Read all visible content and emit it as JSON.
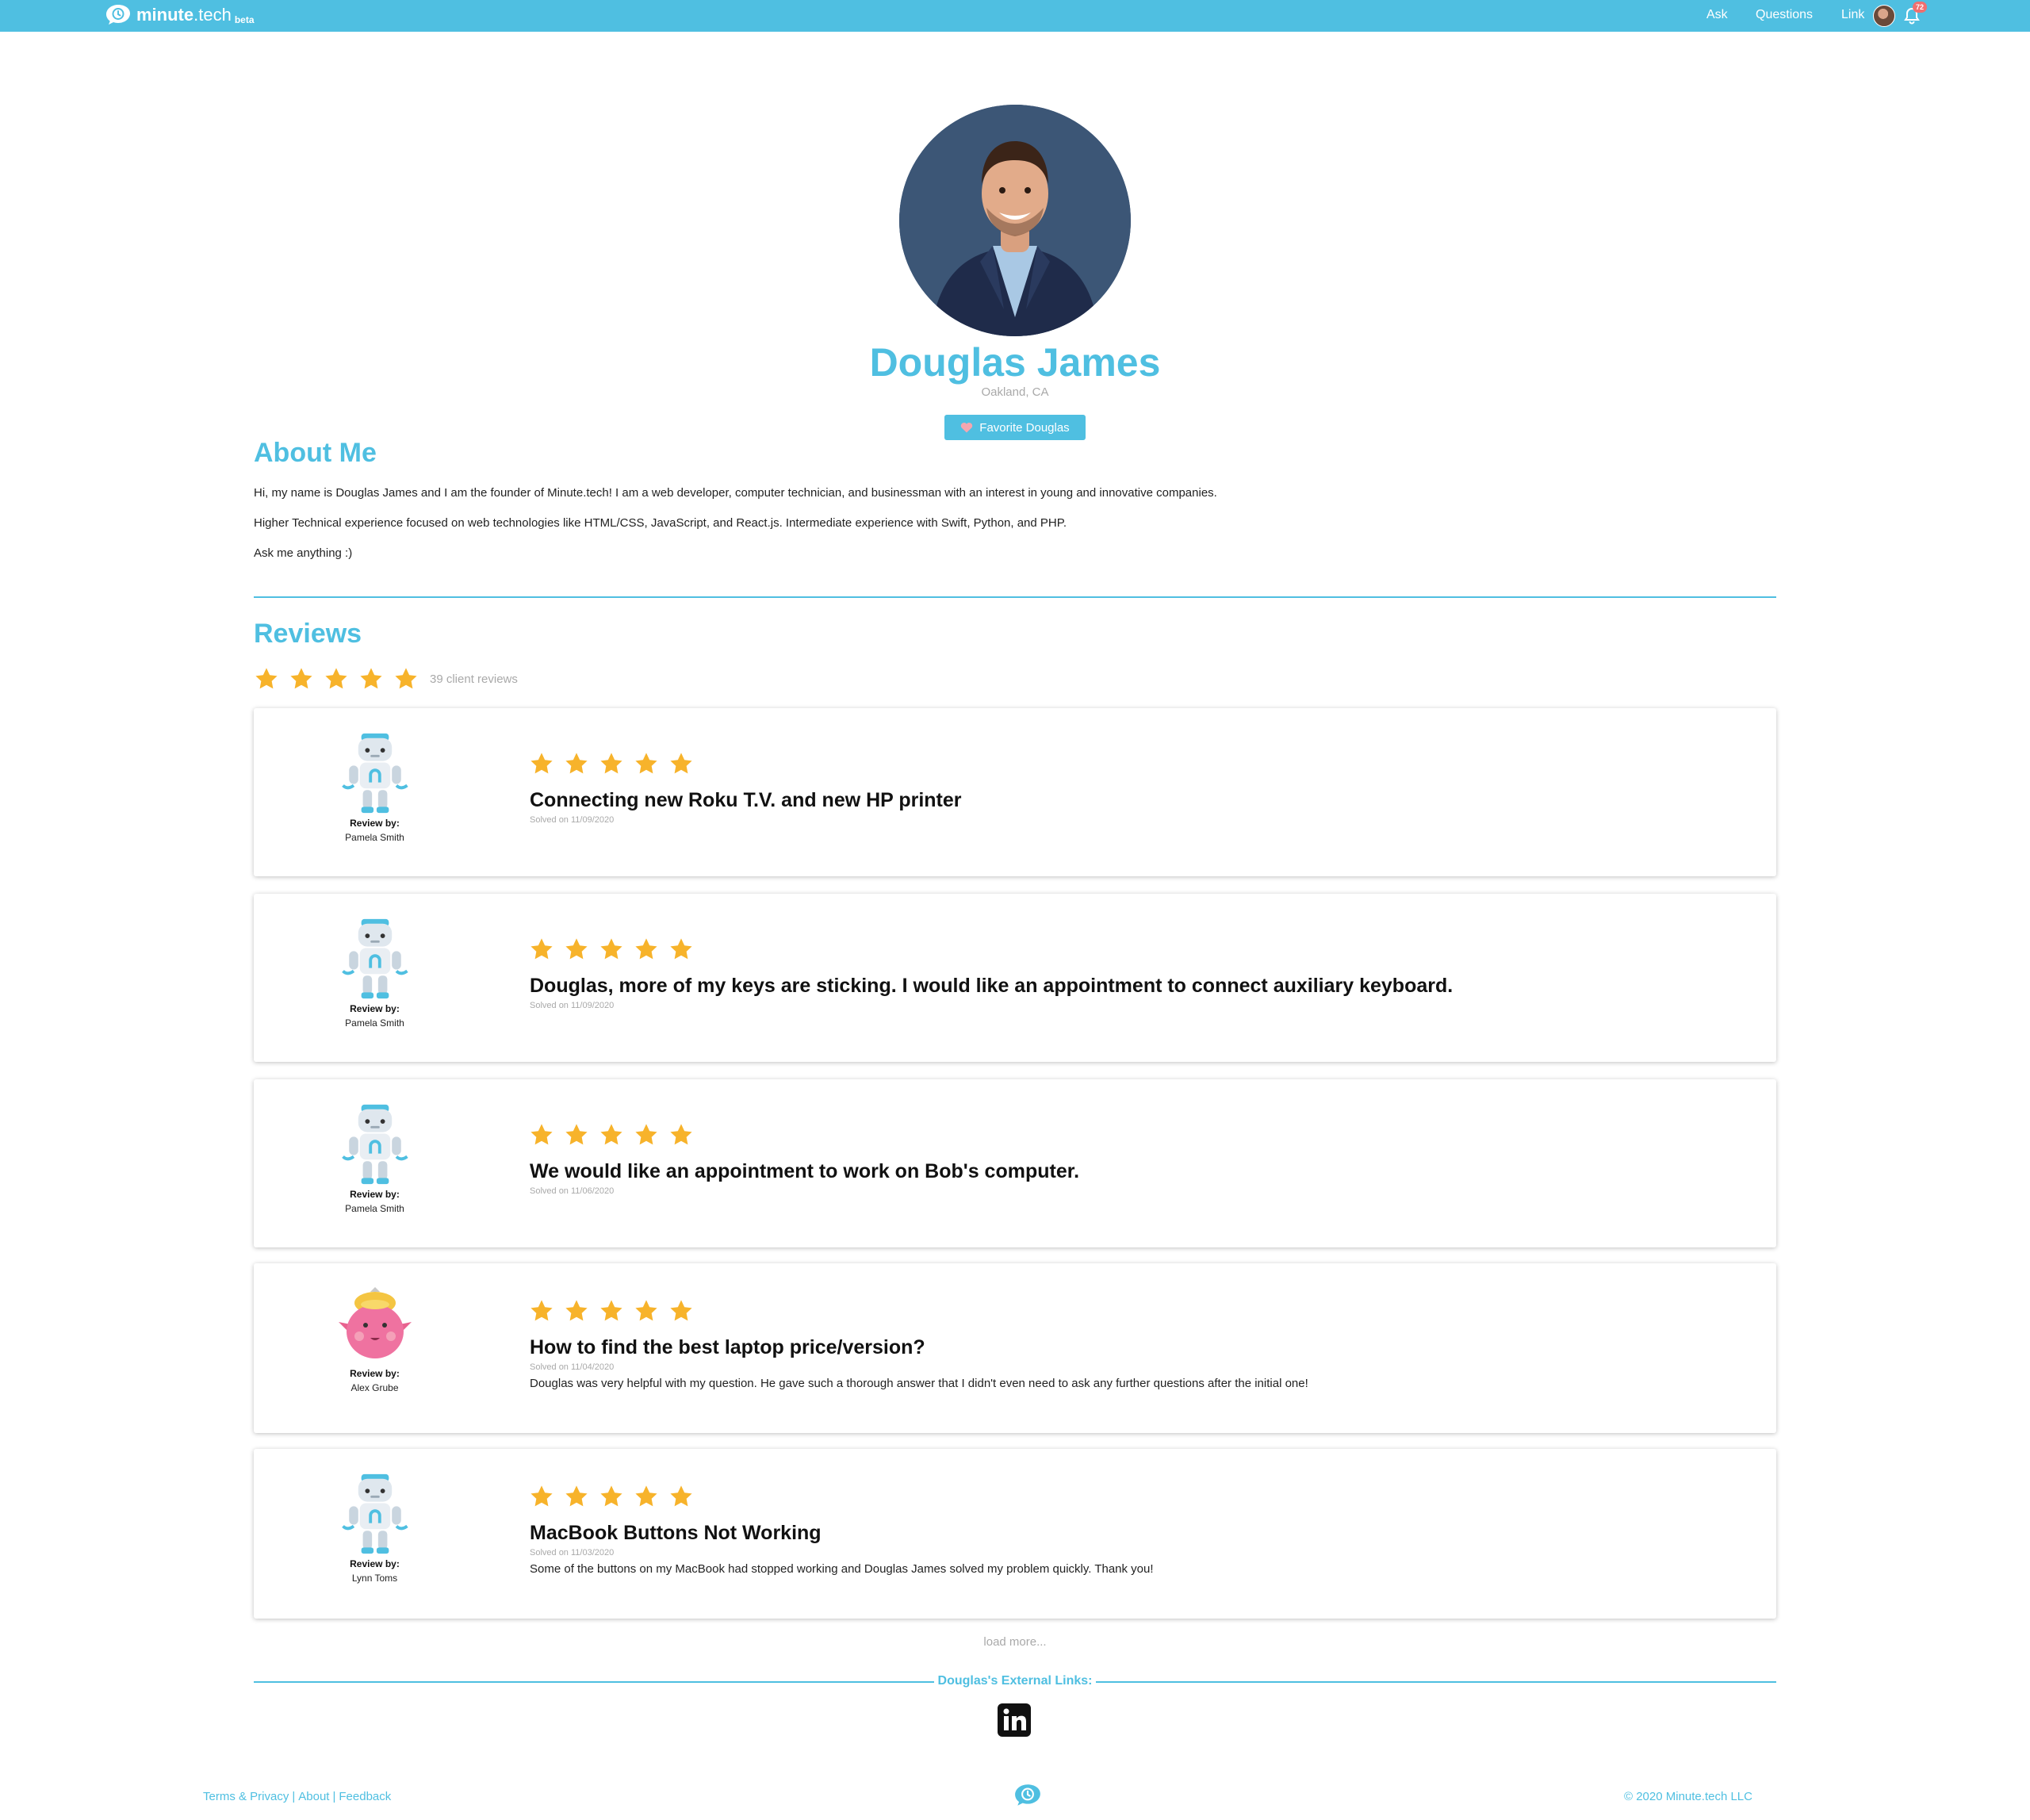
{
  "brand": {
    "name_bold": "minute",
    "name_light": ".tech",
    "badge": "beta",
    "logo_icon": "speech-bubble-clock-icon"
  },
  "nav": {
    "ask": "Ask",
    "questions": "Questions",
    "link": "Link",
    "notifications_count": "72",
    "bell_icon": "bell-icon"
  },
  "profile": {
    "name": "Douglas James",
    "location": "Oakland, CA",
    "favorite_label": "Favorite Douglas"
  },
  "about": {
    "title": "About Me",
    "paragraphs": [
      "Hi, my name is Douglas James and I am the founder of Minute.tech! I am a web developer, computer technician, and businessman with an interest in young and innovative companies.",
      "Higher Technical experience focused on web technologies like HTML/CSS, JavaScript, and React.js. Intermediate experience with Swift, Python, and PHP.",
      "Ask me anything :)"
    ]
  },
  "reviews": {
    "title": "Reviews",
    "rating": 5,
    "count_text": "39 client reviews",
    "review_by_label": "Review by:",
    "items": [
      {
        "reviewer": "Pamela Smith",
        "avatar": "robot-avatar",
        "stars": 5,
        "title": "Connecting new Roku T.V. and new HP printer",
        "solved": "Solved on 11/09/2020",
        "text": ""
      },
      {
        "reviewer": "Pamela Smith",
        "avatar": "robot-avatar",
        "stars": 5,
        "title": "Douglas, more of my keys are sticking. I would like an appointment to connect auxiliary keyboard.",
        "solved": "Solved on 11/09/2020",
        "text": ""
      },
      {
        "reviewer": "Pamela Smith",
        "avatar": "robot-avatar",
        "stars": 5,
        "title": "We would like an appointment to work on Bob's computer.",
        "solved": "Solved on 11/06/2020",
        "text": ""
      },
      {
        "reviewer": "Alex Grube",
        "avatar": "pink-monster-avatar",
        "stars": 5,
        "title": "How to find the best laptop price/version?",
        "solved": "Solved on 11/04/2020",
        "text": "Douglas was very helpful with my question. He gave such a thorough answer that I didn't even need to ask any further questions after the initial one!"
      },
      {
        "reviewer": "Lynn Toms",
        "avatar": "robot-avatar",
        "stars": 5,
        "title": "MacBook Buttons Not Working",
        "solved": "Solved on 11/03/2020",
        "text": "Some of the buttons on my MacBook had stopped working and Douglas James solved my problem quickly. Thank you!"
      }
    ],
    "load_more": "load more..."
  },
  "external": {
    "title": "Douglas's External Links:",
    "linkedin_icon": "linkedin-icon"
  },
  "footer": {
    "terms": "Terms & Privacy",
    "about": "About",
    "feedback": "Feedback",
    "separator": "|",
    "copyright": "© 2020 Minute.tech LLC"
  },
  "colors": {
    "accent": "#4fbfe1",
    "star": "#f7b32b",
    "muted": "#a9a9a9",
    "badge": "#ef6f6f"
  }
}
